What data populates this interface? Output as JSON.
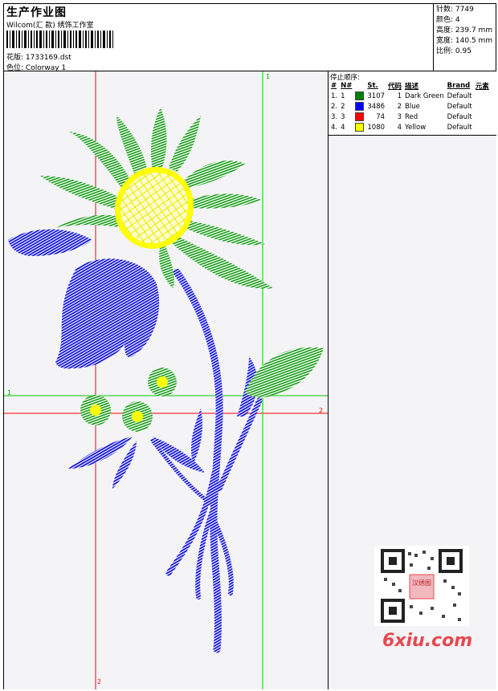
{
  "header": {
    "title": "生产作业图",
    "company": "Wilcom(汇 款) 绣饰工作室",
    "design_label": "花版:",
    "design_value": "1733169.dst",
    "colorway_label": "色位:",
    "colorway_value": "Colorway 1"
  },
  "meta": {
    "stitches_label": "针数:",
    "stitches_value": "7749",
    "colors_label": "颜色:",
    "colors_value": "4",
    "height_label": "高度:",
    "height_value": "239.7 mm",
    "width_label": "宽度:",
    "width_value": "140.5 mm",
    "scale_label": "比例:",
    "scale_value": "0.95"
  },
  "stop_sequence": {
    "title": "停止顺序:",
    "columns": [
      "#",
      "N#",
      "St.",
      "代码",
      "描述",
      "Brand",
      "元素"
    ],
    "rows": [
      {
        "idx": "1.",
        "n": "1",
        "color": "#008000",
        "st": "3107",
        "code": "1",
        "desc": "Dark Green",
        "brand": "Default"
      },
      {
        "idx": "2.",
        "n": "2",
        "color": "#0000ff",
        "st": "3486",
        "code": "2",
        "desc": "Blue",
        "brand": "Default"
      },
      {
        "idx": "3.",
        "n": "3",
        "color": "#ff0000",
        "st": "74",
        "code": "3",
        "desc": "Red",
        "brand": "Default"
      },
      {
        "idx": "4.",
        "n": "4",
        "color": "#ffff00",
        "st": "1080",
        "code": "4",
        "desc": "Yellow",
        "brand": "Default"
      }
    ]
  },
  "guides": {
    "green_label": "1",
    "red_label": "2",
    "green_color": "#00cc00",
    "red_color": "#ff0000"
  },
  "watermark": {
    "logo_text": "6xiu.com",
    "qr_stamp_text": "汉绣图"
  },
  "palette": {
    "green": "#119911",
    "blue": "#1010dd",
    "yellow": "#ffff00"
  }
}
